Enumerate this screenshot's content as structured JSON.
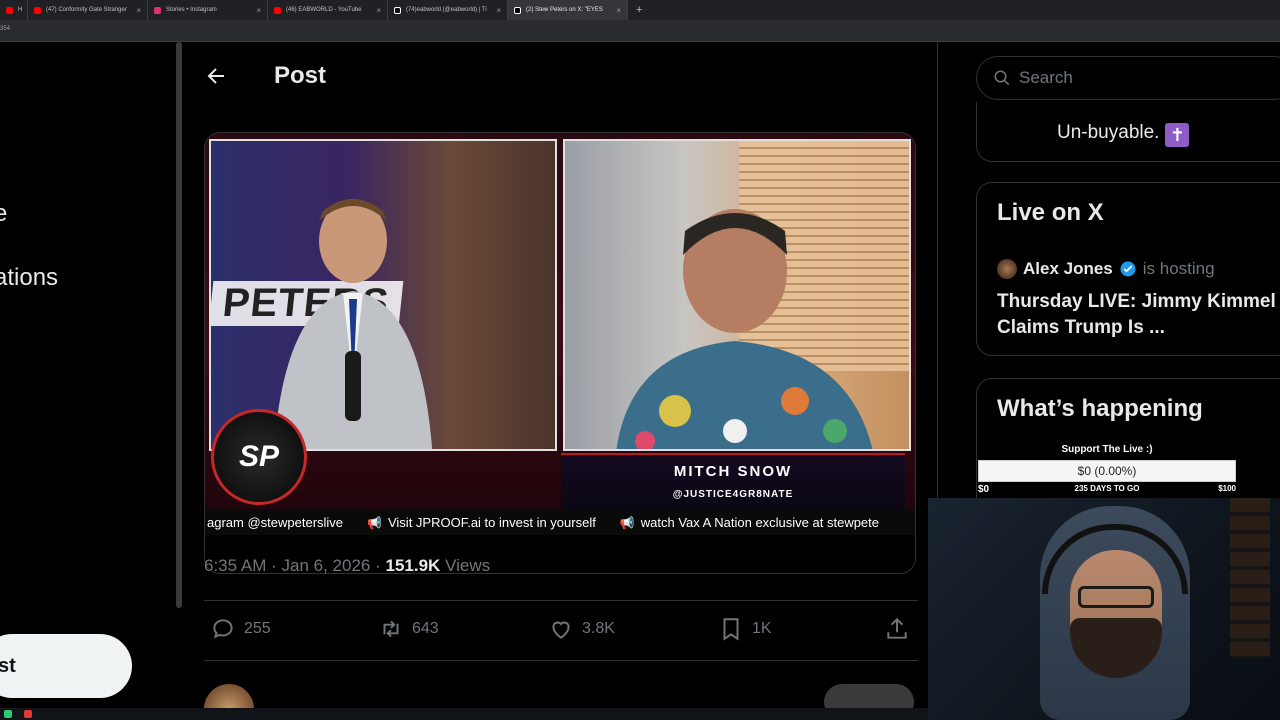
{
  "browser": {
    "tabs": [
      {
        "title": "H",
        "color": "#ff0000"
      },
      {
        "title": "(47) Conformity Gate Stranger",
        "color": "#ff0000"
      },
      {
        "title": "Stories • Instagram",
        "color": "#e1306c"
      },
      {
        "title": "(46) EABWORLD - YouTube",
        "color": "#ff0000"
      },
      {
        "title": "(74)eabworld (@eabworld) | Ti",
        "color": "#ffffff"
      },
      {
        "title": "(2) Stew Peters on X: \"EYES",
        "color": "#ffffff",
        "active": true
      }
    ],
    "new_tab": "+",
    "address_fragment": "354"
  },
  "left_nav": {
    "items": [
      "e",
      "ations"
    ],
    "post_button": "st"
  },
  "header": {
    "back_label": "←",
    "title": "Post"
  },
  "video": {
    "left_backdrop_text": "PETERS",
    "logo_text": "SP",
    "name": "MITCH SNOW",
    "handle": "@JUSTICE4GR8NATE",
    "ticker": [
      "agram @stewpeterslive",
      "Visit JPROOF.ai to invest in yourself",
      "watch Vax A Nation exclusive at stewpete"
    ]
  },
  "post_meta": {
    "time": "6:35 AM",
    "date": "Jan 6, 2026",
    "views_count": "151.9K",
    "views_label": "Views",
    "separator": "·"
  },
  "actions": {
    "replies": "255",
    "reposts": "643",
    "likes": "3.8K",
    "bookmarks": "1K"
  },
  "sidebar": {
    "search_placeholder": "Search",
    "card1_text": "Un-buyable.",
    "card1_emoji": "✝",
    "live": {
      "title": "Live on X",
      "host_name": "Alex Jones",
      "host_suffix": "is hosting",
      "stream_title": "Thursday LIVE: Jimmy Kimmel Claims Trump Is ..."
    },
    "whats_happening": "What’s happening"
  },
  "overlay": {
    "donate_title": "Support The Live :)",
    "donate_progress": "$0 (0.00%)",
    "donate_fraction": 0.0,
    "donate_min": "$0",
    "donate_days": "235 DAYS TO GO",
    "donate_max": "$100"
  },
  "colors": {
    "background": "#000000",
    "text_primary": "#e7e9ea",
    "text_secondary": "#71767b",
    "border": "#2f3336",
    "verified": "#1d9bf0"
  }
}
